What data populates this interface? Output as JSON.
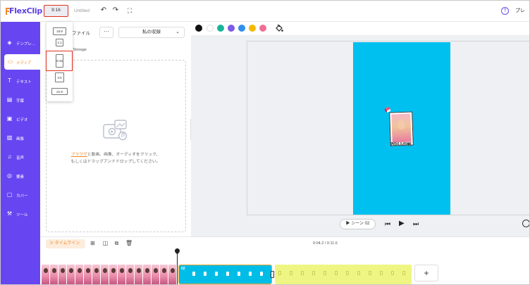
{
  "app": {
    "name": "FlexClip",
    "logo_color": "#5b3ee6",
    "accent": "#6746f1",
    "highlight": "#f08a2a"
  },
  "header": {
    "ratio_button": "9:16",
    "project_title": "Untitled",
    "undo_icon": "undo-icon",
    "redo_icon": "redo-icon",
    "fullscreen_icon": "fullscreen-icon",
    "help_icon": "help-icon",
    "preview_label": "プレ"
  },
  "sidebar": {
    "items": [
      {
        "label": "テンプレ…",
        "icon": "template-icon"
      },
      {
        "label": "メディア",
        "icon": "media-folder-icon",
        "active": true
      },
      {
        "label": "テキスト",
        "icon": "text-icon"
      },
      {
        "label": "字幕",
        "icon": "subtitle-icon"
      },
      {
        "label": "ビデオ",
        "icon": "video-icon"
      },
      {
        "label": "画像",
        "icon": "image-icon"
      },
      {
        "label": "音声",
        "icon": "audio-icon"
      },
      {
        "label": "要素",
        "icon": "elements-icon"
      },
      {
        "label": "カバー",
        "icon": "cover-icon"
      },
      {
        "label": "ツール",
        "icon": "tools-icon"
      }
    ]
  },
  "media_panel": {
    "tab_file": "ファイル",
    "more": "···",
    "collection": "私の収録",
    "storage_label": "d Storage",
    "drop_link": "ブラウザ",
    "drop_text": "と動画、画像、オーディオをクリック、もしくはドラッグアンドドロップしてください。"
  },
  "ratio_menu": {
    "options": [
      "16:9",
      "1:1",
      "9:16",
      "4:5",
      "21:9"
    ],
    "selected": "9:16"
  },
  "color_bar": {
    "swatches": [
      "#111111",
      "#ffffff",
      "#19b59a",
      "#7d5ae8",
      "#2f8ff0",
      "#f5b800",
      "#ef6f95"
    ],
    "fill_icon": "paint-bucket-icon"
  },
  "canvas": {
    "background": "#00c0f0",
    "sticker_text": "FOLLOW"
  },
  "playback": {
    "scene_label": "▶ シーン 02",
    "prev_icon": "skip-back-icon",
    "play_icon": "play-icon",
    "next_icon": "skip-forward-icon"
  },
  "timeline": {
    "toggle_label": "タイムライン",
    "time_display": "0:04.2 / 0:11.6",
    "clip_label": "02",
    "add_label": "+"
  }
}
